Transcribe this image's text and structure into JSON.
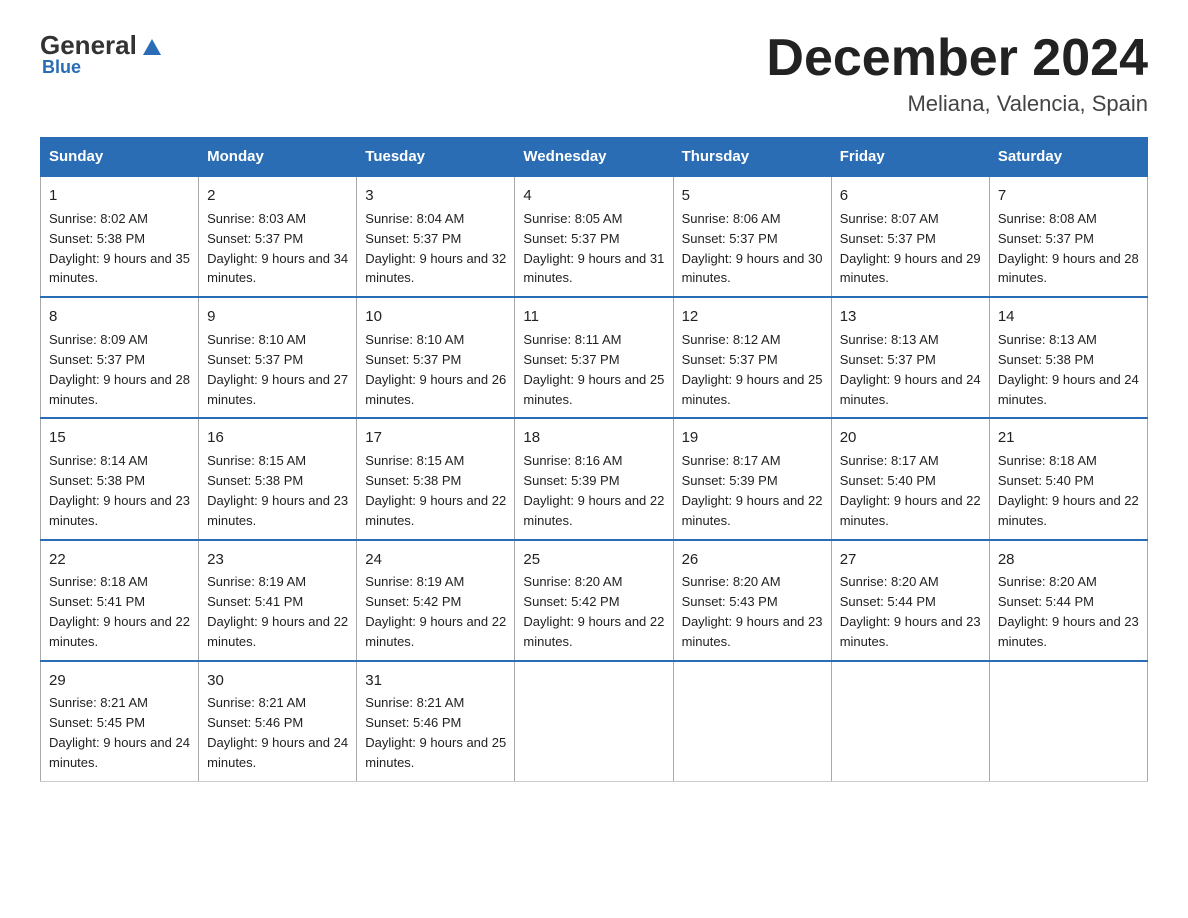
{
  "logo": {
    "general": "General",
    "blue": "Blue"
  },
  "title": "December 2024",
  "subtitle": "Meliana, Valencia, Spain",
  "days_of_week": [
    "Sunday",
    "Monday",
    "Tuesday",
    "Wednesday",
    "Thursday",
    "Friday",
    "Saturday"
  ],
  "weeks": [
    [
      {
        "day": "1",
        "sunrise": "8:02 AM",
        "sunset": "5:38 PM",
        "daylight": "9 hours and 35 minutes."
      },
      {
        "day": "2",
        "sunrise": "8:03 AM",
        "sunset": "5:37 PM",
        "daylight": "9 hours and 34 minutes."
      },
      {
        "day": "3",
        "sunrise": "8:04 AM",
        "sunset": "5:37 PM",
        "daylight": "9 hours and 32 minutes."
      },
      {
        "day": "4",
        "sunrise": "8:05 AM",
        "sunset": "5:37 PM",
        "daylight": "9 hours and 31 minutes."
      },
      {
        "day": "5",
        "sunrise": "8:06 AM",
        "sunset": "5:37 PM",
        "daylight": "9 hours and 30 minutes."
      },
      {
        "day": "6",
        "sunrise": "8:07 AM",
        "sunset": "5:37 PM",
        "daylight": "9 hours and 29 minutes."
      },
      {
        "day": "7",
        "sunrise": "8:08 AM",
        "sunset": "5:37 PM",
        "daylight": "9 hours and 28 minutes."
      }
    ],
    [
      {
        "day": "8",
        "sunrise": "8:09 AM",
        "sunset": "5:37 PM",
        "daylight": "9 hours and 28 minutes."
      },
      {
        "day": "9",
        "sunrise": "8:10 AM",
        "sunset": "5:37 PM",
        "daylight": "9 hours and 27 minutes."
      },
      {
        "day": "10",
        "sunrise": "8:10 AM",
        "sunset": "5:37 PM",
        "daylight": "9 hours and 26 minutes."
      },
      {
        "day": "11",
        "sunrise": "8:11 AM",
        "sunset": "5:37 PM",
        "daylight": "9 hours and 25 minutes."
      },
      {
        "day": "12",
        "sunrise": "8:12 AM",
        "sunset": "5:37 PM",
        "daylight": "9 hours and 25 minutes."
      },
      {
        "day": "13",
        "sunrise": "8:13 AM",
        "sunset": "5:37 PM",
        "daylight": "9 hours and 24 minutes."
      },
      {
        "day": "14",
        "sunrise": "8:13 AM",
        "sunset": "5:38 PM",
        "daylight": "9 hours and 24 minutes."
      }
    ],
    [
      {
        "day": "15",
        "sunrise": "8:14 AM",
        "sunset": "5:38 PM",
        "daylight": "9 hours and 23 minutes."
      },
      {
        "day": "16",
        "sunrise": "8:15 AM",
        "sunset": "5:38 PM",
        "daylight": "9 hours and 23 minutes."
      },
      {
        "day": "17",
        "sunrise": "8:15 AM",
        "sunset": "5:38 PM",
        "daylight": "9 hours and 22 minutes."
      },
      {
        "day": "18",
        "sunrise": "8:16 AM",
        "sunset": "5:39 PM",
        "daylight": "9 hours and 22 minutes."
      },
      {
        "day": "19",
        "sunrise": "8:17 AM",
        "sunset": "5:39 PM",
        "daylight": "9 hours and 22 minutes."
      },
      {
        "day": "20",
        "sunrise": "8:17 AM",
        "sunset": "5:40 PM",
        "daylight": "9 hours and 22 minutes."
      },
      {
        "day": "21",
        "sunrise": "8:18 AM",
        "sunset": "5:40 PM",
        "daylight": "9 hours and 22 minutes."
      }
    ],
    [
      {
        "day": "22",
        "sunrise": "8:18 AM",
        "sunset": "5:41 PM",
        "daylight": "9 hours and 22 minutes."
      },
      {
        "day": "23",
        "sunrise": "8:19 AM",
        "sunset": "5:41 PM",
        "daylight": "9 hours and 22 minutes."
      },
      {
        "day": "24",
        "sunrise": "8:19 AM",
        "sunset": "5:42 PM",
        "daylight": "9 hours and 22 minutes."
      },
      {
        "day": "25",
        "sunrise": "8:20 AM",
        "sunset": "5:42 PM",
        "daylight": "9 hours and 22 minutes."
      },
      {
        "day": "26",
        "sunrise": "8:20 AM",
        "sunset": "5:43 PM",
        "daylight": "9 hours and 23 minutes."
      },
      {
        "day": "27",
        "sunrise": "8:20 AM",
        "sunset": "5:44 PM",
        "daylight": "9 hours and 23 minutes."
      },
      {
        "day": "28",
        "sunrise": "8:20 AM",
        "sunset": "5:44 PM",
        "daylight": "9 hours and 23 minutes."
      }
    ],
    [
      {
        "day": "29",
        "sunrise": "8:21 AM",
        "sunset": "5:45 PM",
        "daylight": "9 hours and 24 minutes."
      },
      {
        "day": "30",
        "sunrise": "8:21 AM",
        "sunset": "5:46 PM",
        "daylight": "9 hours and 24 minutes."
      },
      {
        "day": "31",
        "sunrise": "8:21 AM",
        "sunset": "5:46 PM",
        "daylight": "9 hours and 25 minutes."
      },
      null,
      null,
      null,
      null
    ]
  ]
}
